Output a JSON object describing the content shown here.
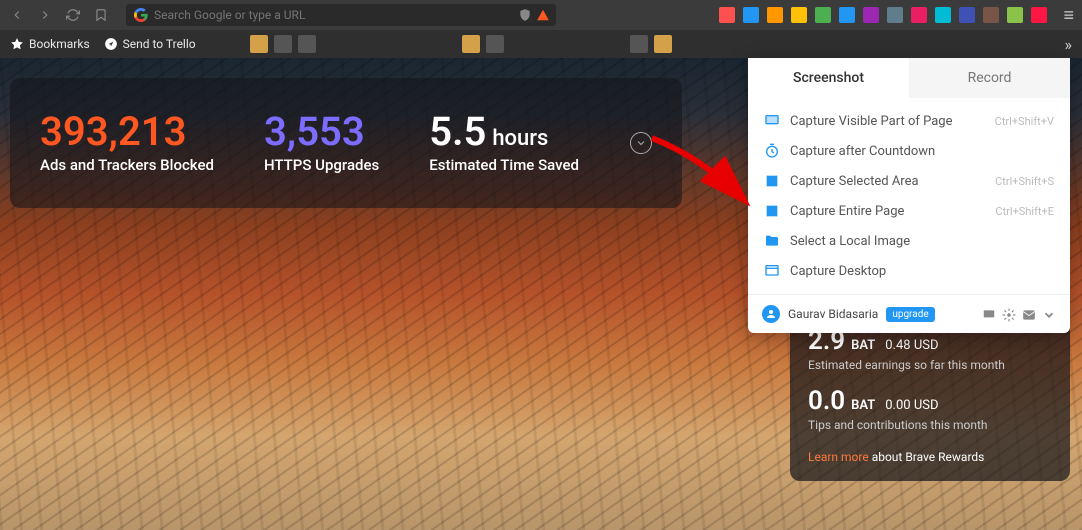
{
  "toolbar": {
    "url_placeholder": "Search Google or type a URL"
  },
  "bookmarks": {
    "label": "Bookmarks",
    "trello": "Send to Trello",
    "overflow": "»"
  },
  "stats": {
    "ads_num": "393,213",
    "ads_label": "Ads and Trackers Blocked",
    "https_num": "3,553",
    "https_label": "HTTPS Upgrades",
    "time_num": "5.5",
    "time_unit": "hours",
    "time_label": "Estimated Time Saved"
  },
  "popup": {
    "tab_screenshot": "Screenshot",
    "tab_record": "Record",
    "items": [
      {
        "label": "Capture Visible Part of Page",
        "shortcut": "Ctrl+Shift+V",
        "icon": "monitor",
        "color": "#2196f3"
      },
      {
        "label": "Capture after Countdown",
        "shortcut": "",
        "icon": "timer",
        "color": "#2196f3"
      },
      {
        "label": "Capture Selected Area",
        "shortcut": "Ctrl+Shift+S",
        "icon": "square",
        "color": "#2196f3"
      },
      {
        "label": "Capture Entire Page",
        "shortcut": "Ctrl+Shift+E",
        "icon": "square",
        "color": "#2196f3"
      },
      {
        "label": "Select a Local Image",
        "shortcut": "",
        "icon": "folder",
        "color": "#2196f3"
      },
      {
        "label": "Capture Desktop",
        "shortcut": "",
        "icon": "window",
        "color": "#2196f3"
      }
    ],
    "user": "Gaurav Bidasaria",
    "upgrade": "upgrade"
  },
  "rewards": {
    "r1_num": "2.9",
    "r1_cur": "BAT",
    "r1_usd": "0.48 USD",
    "r1_sub": "Estimated earnings so far this month",
    "r2_num": "0.0",
    "r2_cur": "BAT",
    "r2_usd": "0.00 USD",
    "r2_sub": "Tips and contributions this month",
    "learn": "Learn more",
    "about": " about Brave Rewards"
  },
  "ext_colors": [
    "#ff5050",
    "#2196f3",
    "#ff9800",
    "#ffc107",
    "#4caf50",
    "#2196f3",
    "#9c27b0",
    "#607d8b",
    "#e91e63",
    "#00bcd4",
    "#3f51b5",
    "#795548",
    "#8bc34a",
    "#ff1744"
  ]
}
